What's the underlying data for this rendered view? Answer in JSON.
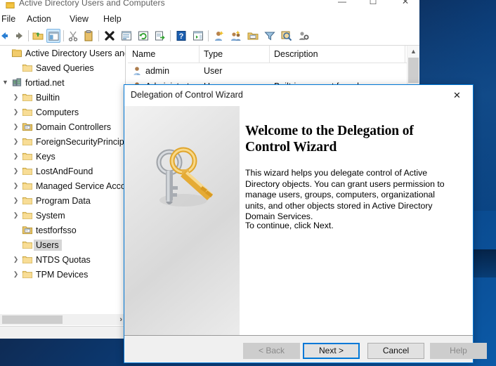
{
  "desktop": {
    "background_color": "#0d2447",
    "accent_color": "#0b5aa8"
  },
  "mmc_window": {
    "title": "Active Directory Users and Computers",
    "icon": "mmc-console-icon",
    "window_controls": {
      "minimize": "—",
      "maximize": "☐",
      "close": "✕"
    },
    "menubar": [
      {
        "label": "File",
        "name": "menu-file"
      },
      {
        "label": "Action",
        "name": "menu-action"
      },
      {
        "label": "View",
        "name": "menu-view"
      },
      {
        "label": "Help",
        "name": "menu-help"
      }
    ],
    "toolbar": [
      {
        "name": "back-icon"
      },
      {
        "name": "forward-icon"
      },
      {
        "name": "up-folder-icon"
      },
      {
        "name": "show-hide-console-tree-icon"
      },
      {
        "name": "cut-icon"
      },
      {
        "name": "paste-icon"
      },
      {
        "name": "delete-icon"
      },
      {
        "name": "properties-icon"
      },
      {
        "name": "refresh-icon"
      },
      {
        "name": "export-list-icon"
      },
      {
        "name": "help-icon"
      },
      {
        "name": "show-hide-action-pane-icon"
      },
      {
        "name": "new-user-icon"
      },
      {
        "name": "new-group-icon"
      },
      {
        "name": "new-ou-icon"
      },
      {
        "name": "filter-icon"
      },
      {
        "name": "find-icon"
      },
      {
        "name": "manage-icon"
      }
    ],
    "tree": {
      "items": [
        {
          "label": "Active Directory Users and Com",
          "icon": "console-root-icon",
          "indent": 0,
          "chevron": "",
          "selected": false
        },
        {
          "label": "Saved Queries",
          "icon": "folder-icon",
          "indent": 1,
          "chevron": "",
          "selected": false
        },
        {
          "label": "fortiad.net",
          "icon": "domain-icon",
          "indent": 0,
          "chevron": "expanded",
          "selected": false
        },
        {
          "label": "Builtin",
          "icon": "folder-icon",
          "indent": 1,
          "chevron": "collapsed",
          "selected": false
        },
        {
          "label": "Computers",
          "icon": "folder-icon",
          "indent": 1,
          "chevron": "collapsed",
          "selected": false
        },
        {
          "label": "Domain Controllers",
          "icon": "ou-folder-icon",
          "indent": 1,
          "chevron": "collapsed",
          "selected": false
        },
        {
          "label": "ForeignSecurityPrincipa",
          "icon": "folder-icon",
          "indent": 1,
          "chevron": "collapsed",
          "selected": false
        },
        {
          "label": "Keys",
          "icon": "folder-icon",
          "indent": 1,
          "chevron": "collapsed",
          "selected": false
        },
        {
          "label": "LostAndFound",
          "icon": "folder-icon",
          "indent": 1,
          "chevron": "collapsed",
          "selected": false
        },
        {
          "label": "Managed Service Accou",
          "icon": "folder-icon",
          "indent": 1,
          "chevron": "collapsed",
          "selected": false
        },
        {
          "label": "Program Data",
          "icon": "folder-icon",
          "indent": 1,
          "chevron": "collapsed",
          "selected": false
        },
        {
          "label": "System",
          "icon": "folder-icon",
          "indent": 1,
          "chevron": "collapsed",
          "selected": false
        },
        {
          "label": "testforfsso",
          "icon": "ou-folder-icon",
          "indent": 1,
          "chevron": "",
          "selected": false
        },
        {
          "label": "Users",
          "icon": "folder-icon",
          "indent": 1,
          "chevron": "",
          "selected": true
        },
        {
          "label": "NTDS Quotas",
          "icon": "folder-icon",
          "indent": 1,
          "chevron": "collapsed",
          "selected": false
        },
        {
          "label": "TPM Devices",
          "icon": "folder-icon",
          "indent": 1,
          "chevron": "collapsed",
          "selected": false
        }
      ]
    },
    "list_view": {
      "columns": [
        "Name",
        "Type",
        "Description"
      ],
      "rows": [
        {
          "name": "admin",
          "type": "User",
          "description": "",
          "icon": "user-icon"
        },
        {
          "name": "Administrator",
          "type": "User",
          "description": "Built-in account for ad",
          "icon": "user-icon"
        }
      ]
    }
  },
  "dialog": {
    "title": "Delegation of Control Wizard",
    "close_label": "✕",
    "watermark_icon": "keys-icon",
    "heading": "Welcome to the Delegation of Control Wizard",
    "paragraph": "This wizard helps you delegate control of Active Directory objects. You can grant users permission to manage users, groups, computers, organizational units, and other objects stored in Active Directory Domain Services.",
    "paragraph2": "To continue, click Next.",
    "buttons": {
      "back": "< Back",
      "next": "Next >",
      "cancel": "Cancel",
      "help": "Help"
    },
    "accent_color": "#0078d7"
  }
}
